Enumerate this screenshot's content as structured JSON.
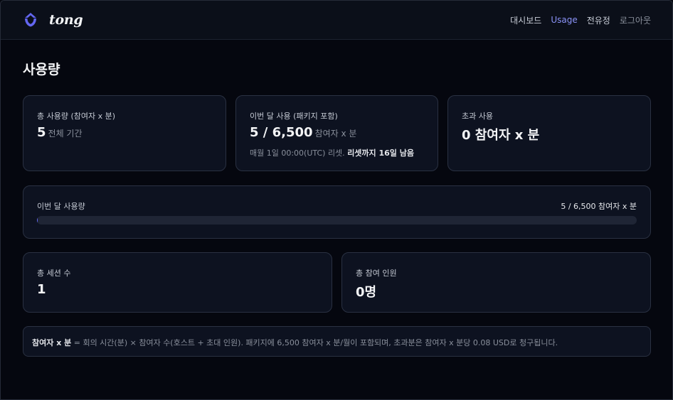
{
  "app": {
    "name": "tong"
  },
  "nav": {
    "items": [
      {
        "label": "대시보드",
        "state": "default"
      },
      {
        "label": "Usage",
        "state": "active"
      },
      {
        "label": "전유정",
        "state": "default"
      },
      {
        "label": "로그아웃",
        "state": "muted"
      }
    ]
  },
  "page": {
    "title": "사용량"
  },
  "stats": {
    "total": {
      "label": "총 사용량 (참여자 x 분)",
      "value": "5",
      "unit": "전체 기간"
    },
    "month": {
      "label": "이번 달 사용 (패키지 포함)",
      "value": "5 / 6,500",
      "unit": "참여자 x 분",
      "reset_text": "매월 1일 00:00(UTC) 리셋.",
      "reset_bold": "리셋까지 16일 남음"
    },
    "overage": {
      "label": "초과 사용",
      "value": "0 참여자 x 분"
    }
  },
  "progress": {
    "label": "이번 달 사용량",
    "value_text": "5 / 6,500 참여자 x 분",
    "used": 5,
    "total": 6500
  },
  "sessions": {
    "label": "총 세션 수",
    "value": "1"
  },
  "participants": {
    "label": "총 참여 인원",
    "value": "0명"
  },
  "note": {
    "bold": "참여자 x 분",
    "text": " = 회의 시간(분) × 참여자 수(호스트 + 초대 인원). 패키지에 6,500 참여자 x 분/월이 포함되며, 초과분은 참여자 x 분당 0.08 USD로 청구됩니다."
  },
  "colors": {
    "accent": "#6366f1",
    "nav_active": "#8b93f8",
    "background": "#05070f",
    "card": "#0d1220"
  }
}
